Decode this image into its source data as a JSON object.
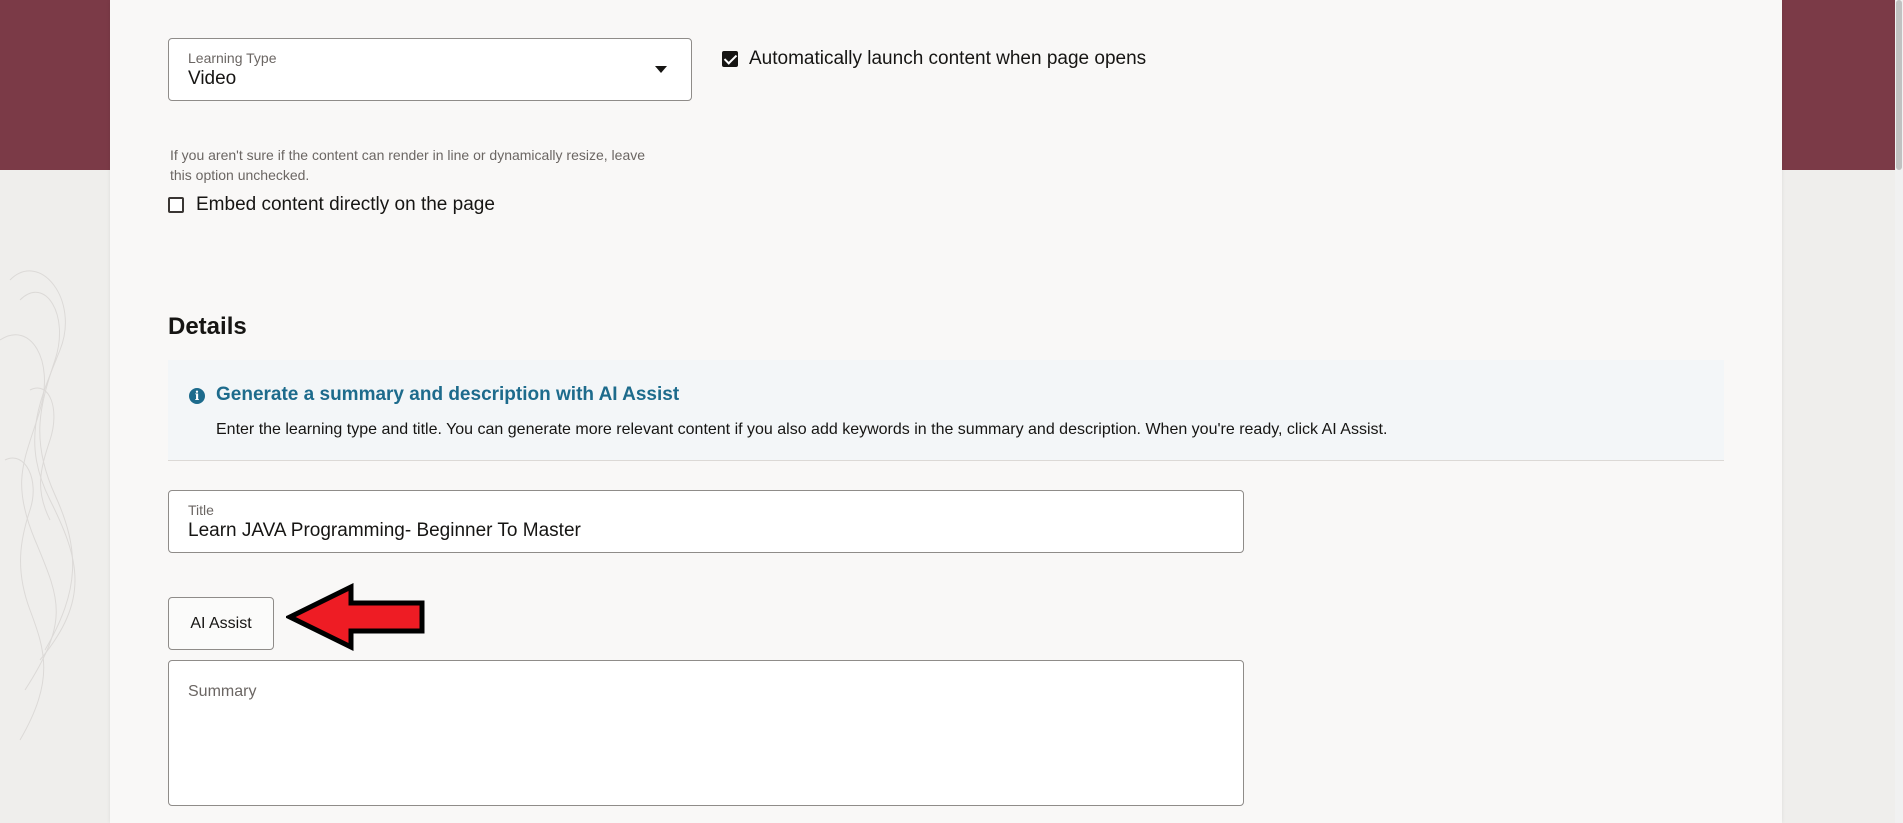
{
  "learning_type": {
    "label": "Learning Type",
    "value": "Video"
  },
  "auto_launch": {
    "label": "Automatically launch content when page opens",
    "checked": true
  },
  "embed": {
    "help_line1": "If you aren't sure if the content can render in line or dynamically resize, leave",
    "help_line2": "this option unchecked.",
    "label": "Embed content directly on the page",
    "checked": false
  },
  "details": {
    "heading": "Details"
  },
  "ai_info": {
    "title": "Generate a summary and description with AI Assist",
    "text": "Enter the learning type and title. You can generate more relevant content if you also add keywords in the summary and description. When you're ready, click AI Assist.",
    "icon": "info-icon"
  },
  "title_field": {
    "label": "Title",
    "value": "Learn JAVA Programming- Beginner To Master"
  },
  "ai_assist": {
    "label": "AI Assist"
  },
  "summary_field": {
    "label": "Summary",
    "value": ""
  },
  "colors": {
    "banner": "#7b3a47",
    "accent": "#1d6b8c",
    "arrow": "#ee1c24"
  }
}
